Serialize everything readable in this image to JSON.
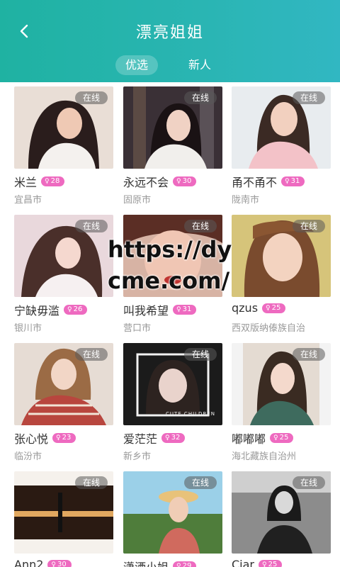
{
  "header": {
    "title": "漂亮姐姐",
    "back_icon": "chevron-left-icon",
    "tabs": [
      {
        "label": "优选",
        "active": true
      },
      {
        "label": "新人",
        "active": false
      }
    ]
  },
  "status_label": "在线",
  "age_icon": "gender-symbol-icon",
  "colors": {
    "header_start": "#1fb2a2",
    "header_end": "#31b7c2",
    "age_badge": "#ee6ac0"
  },
  "profiles": [
    {
      "name": "米兰",
      "age": "28",
      "city": "宜昌市",
      "status": "在线"
    },
    {
      "name": "永远不会",
      "age": "30",
      "city": "固原市",
      "status": "在线"
    },
    {
      "name": "甬不甬不",
      "age": "31",
      "city": "陇南市",
      "status": "在线"
    },
    {
      "name": "宁缺毋滥",
      "age": "26",
      "city": "银川市",
      "status": "在线"
    },
    {
      "name": "叫我希望",
      "age": "31",
      "city": "营口市",
      "status": "在线"
    },
    {
      "name": "qzus",
      "age": "25",
      "city": "西双版纳傣族自治",
      "status": "在线"
    },
    {
      "name": "张心悦",
      "age": "23",
      "city": "临汾市",
      "status": "在线"
    },
    {
      "name": "爱茫茫",
      "age": "32",
      "city": "新乡市",
      "status": "在线"
    },
    {
      "name": "嘟嘟嘟",
      "age": "25",
      "city": "海北藏族自治州",
      "status": "在线"
    },
    {
      "name": "Ann2",
      "age": "30",
      "city": "",
      "status": "在线"
    },
    {
      "name": "潇洒小姐",
      "age": "29",
      "city": "",
      "status": "在线"
    },
    {
      "name": "Ciar",
      "age": "25",
      "city": "",
      "status": "在线"
    }
  ],
  "photo_caption": "CUTE CHILDREN",
  "watermark": "https://dycme.com/"
}
